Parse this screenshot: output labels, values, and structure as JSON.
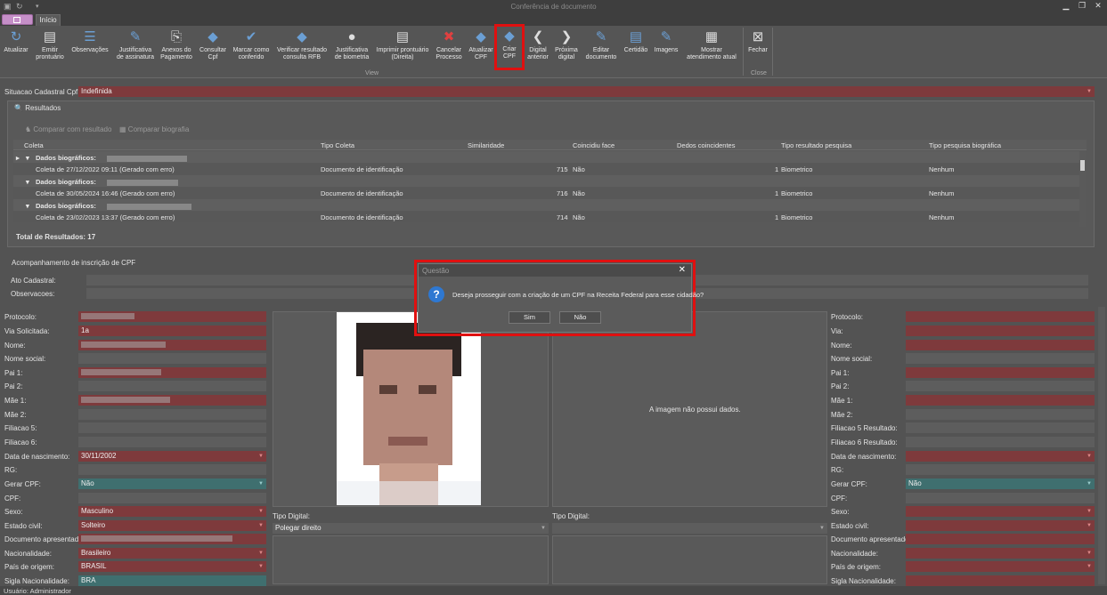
{
  "window": {
    "title": "Conferência de documento"
  },
  "tabs": {
    "inicio": "Início"
  },
  "ribbon": {
    "group_view": "View",
    "group_close": "Close",
    "buttons": [
      {
        "id": "atualizar",
        "label": "Atualizar",
        "icon": "refresh-icon"
      },
      {
        "id": "emitir-prontuario",
        "label": "Emitir\nprontuário",
        "icon": "printer-icon"
      },
      {
        "id": "observacoes",
        "label": "Observações",
        "icon": "list-icon"
      },
      {
        "id": "justificativa-assinatura",
        "label": "Justificativa\nde assinatura",
        "icon": "pen-icon"
      },
      {
        "id": "anexos-pagamento",
        "label": "Anexos do\nPagamento",
        "icon": "attachment-icon"
      },
      {
        "id": "consultar-cpf",
        "label": "Consultar\nCpf",
        "icon": "receita-logo-icon"
      },
      {
        "id": "marcar-conferido",
        "label": "Marcar como\nconferido",
        "icon": "check-icon"
      },
      {
        "id": "verificar-rfb",
        "label": "Verificar resultado\nconsulta RFB",
        "icon": "receita-logo-icon"
      },
      {
        "id": "justificativa-biometria",
        "label": "Justificativa\nde biometria",
        "icon": "person-icon"
      },
      {
        "id": "imprimir-prontuario",
        "label": "Imprimir prontuário\n(Direita)",
        "icon": "printer-icon"
      },
      {
        "id": "cancelar-processo",
        "label": "Cancelar\nProcesso",
        "icon": "cancel-doc-icon"
      },
      {
        "id": "atualizar-cpf",
        "label": "Atualizar\nCPF",
        "icon": "receita-logo-icon"
      },
      {
        "id": "criar-cpf",
        "label": "Criar\nCPF",
        "icon": "receita-logo-icon"
      },
      {
        "id": "digital-anterior",
        "label": "Digital\nanterior",
        "icon": "chevron-left-icon"
      },
      {
        "id": "proxima-digital",
        "label": "Próxima\ndigital",
        "icon": "chevron-right-icon"
      },
      {
        "id": "editar-documento",
        "label": "Editar\ndocumento",
        "icon": "edit-icon"
      },
      {
        "id": "certidao",
        "label": "Certidão",
        "icon": "document-icon"
      },
      {
        "id": "imagens",
        "label": "Imagens",
        "icon": "edit-icon"
      },
      {
        "id": "mostrar-atendimento",
        "label": "Mostrar\natendimento atual",
        "icon": "form-icon"
      },
      {
        "id": "fechar",
        "label": "Fechar",
        "icon": "close-box-icon"
      }
    ]
  },
  "situacao": {
    "label": "Situacao Cadastral Cpf:",
    "value": "Indefinida"
  },
  "resultados": {
    "tab_label": "Resultados",
    "btn_comparar_resultado": "Comparar com resultado",
    "btn_comparar_biografia": "Comparar biografia",
    "columns": [
      "Coleta",
      "Tipo Coleta",
      "Similaridade",
      "Coincidiu face",
      "Dedos coincidentes",
      "Tipo resultado pesquisa",
      "Tipo pesquisa biográfica"
    ],
    "group_label": "Dados biográficos:",
    "rows": [
      {
        "coleta": "Coleta de 27/12/2022 09:11 (Gerado com erro)",
        "tipo": "Documento de identificação",
        "sim": "715",
        "face": "Não",
        "dedos": "1",
        "resultado": "Biometrico",
        "pesquisa": "Nenhum"
      },
      {
        "coleta": "Coleta de 30/05/2024 16:46 (Gerado com erro)",
        "tipo": "Documento de identificação",
        "sim": "716",
        "face": "Não",
        "dedos": "1",
        "resultado": "Biometrico",
        "pesquisa": "Nenhum"
      },
      {
        "coleta": "Coleta de 23/02/2023 13:37 (Gerado com erro)",
        "tipo": "Documento de identificação",
        "sim": "714",
        "face": "Não",
        "dedos": "1",
        "resultado": "Biometrico",
        "pesquisa": "Nenhum"
      }
    ],
    "total": "Total de Resultados: 17"
  },
  "acompanhamento": {
    "title": "Acompanhamento de inscrição de CPF",
    "ato_label": "Ato Cadastral:",
    "obs_label": "Observacoes:"
  },
  "left_form": {
    "protocolo": "Protocolo:",
    "via": "Via Solicitada:",
    "via_value": "1a",
    "nome": "Nome:",
    "nome_social": "Nome social:",
    "pai1": "Pai 1:",
    "pai2": "Pai 2:",
    "mae1": "Mãe 1:",
    "mae2": "Mãe 2:",
    "filiacao5": "Filiacao 5:",
    "filiacao6": "Filiacao 6:",
    "nascimento": "Data de nascimento:",
    "nascimento_value": "30/11/2002",
    "rg": "RG:",
    "gerar_cpf": "Gerar CPF:",
    "gerar_cpf_value": "Não",
    "cpf": "CPF:",
    "sexo": "Sexo:",
    "sexo_value": "Masculino",
    "estado_civil": "Estado civil:",
    "estado_civil_value": "Solteiro",
    "doc_apresentado": "Documento apresentado:",
    "nacionalidade": "Nacionalidade:",
    "nacionalidade_value": "Brasileiro",
    "pais": "País de origem:",
    "pais_value": "BRASIL",
    "sigla": "Sigla Nacionalidade:",
    "sigla_value": "BRA"
  },
  "right_form": {
    "protocolo": "Protocolo:",
    "via": "Via:",
    "nome": "Nome:",
    "nome_social": "Nome social:",
    "pai1": "Pai 1:",
    "pai2": "Pai 2:",
    "mae1": "Mãe 1:",
    "mae2": "Mãe 2:",
    "filiacao5": "Filiacao 5 Resultado:",
    "filiacao6": "Filiacao 6 Resultado:",
    "nascimento": "Data de nascimento:",
    "rg": "RG:",
    "gerar_cpf": "Gerar CPF:",
    "gerar_cpf_value": "Não",
    "cpf": "CPF:",
    "sexo": "Sexo:",
    "estado_civil": "Estado civil:",
    "doc_apresentado": "Documento apresentado:",
    "nacionalidade": "Nacionalidade:",
    "pais": "País de origem:",
    "sigla": "Sigla Nacionalidade:"
  },
  "center": {
    "tipo_digital_label": "Tipo Digital:",
    "tipo_digital_value": "Polegar direito",
    "tipo_digital_label2": "Tipo Digital:",
    "no_image": "A imagem não possui dados."
  },
  "dialog": {
    "title": "Questão",
    "message": "Deseja prosseguir com a criação de um CPF na Receita Federal para esse cidadão?",
    "yes": "Sim",
    "no": "Não"
  },
  "status": {
    "user": "Usuário: Administrador"
  }
}
